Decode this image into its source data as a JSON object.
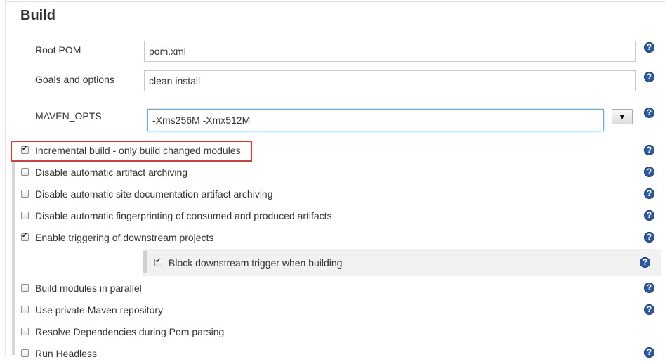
{
  "section": {
    "title": "Build"
  },
  "fields": {
    "root_pom": {
      "label": "Root POM",
      "value": "pom.xml"
    },
    "goals": {
      "label": "Goals and options",
      "value": "clean install"
    },
    "maven_opts": {
      "label": "MAVEN_OPTS",
      "value": "-Xms256M -Xmx512M",
      "dropdown_glyph": "▼"
    }
  },
  "help_glyph": "?",
  "checkboxes": [
    {
      "label": "Incremental build - only build changed modules",
      "checked": true
    },
    {
      "label": "Disable automatic artifact archiving",
      "checked": false
    },
    {
      "label": "Disable automatic site documentation artifact archiving",
      "checked": false
    },
    {
      "label": "Disable automatic fingerprinting of consumed and produced artifacts",
      "checked": false
    },
    {
      "label": "Enable triggering of downstream projects",
      "checked": true
    },
    {
      "label": "Block downstream trigger when building",
      "checked": true
    },
    {
      "label": "Build modules in parallel",
      "checked": false
    },
    {
      "label": "Use private Maven repository",
      "checked": false
    },
    {
      "label": "Resolve Dependencies during Pom parsing",
      "checked": false
    },
    {
      "label": "Run Headless",
      "checked": false
    }
  ],
  "colors": {
    "help": "#2c5aa0",
    "highlight": "#e53935",
    "focus": "#66afe9"
  }
}
